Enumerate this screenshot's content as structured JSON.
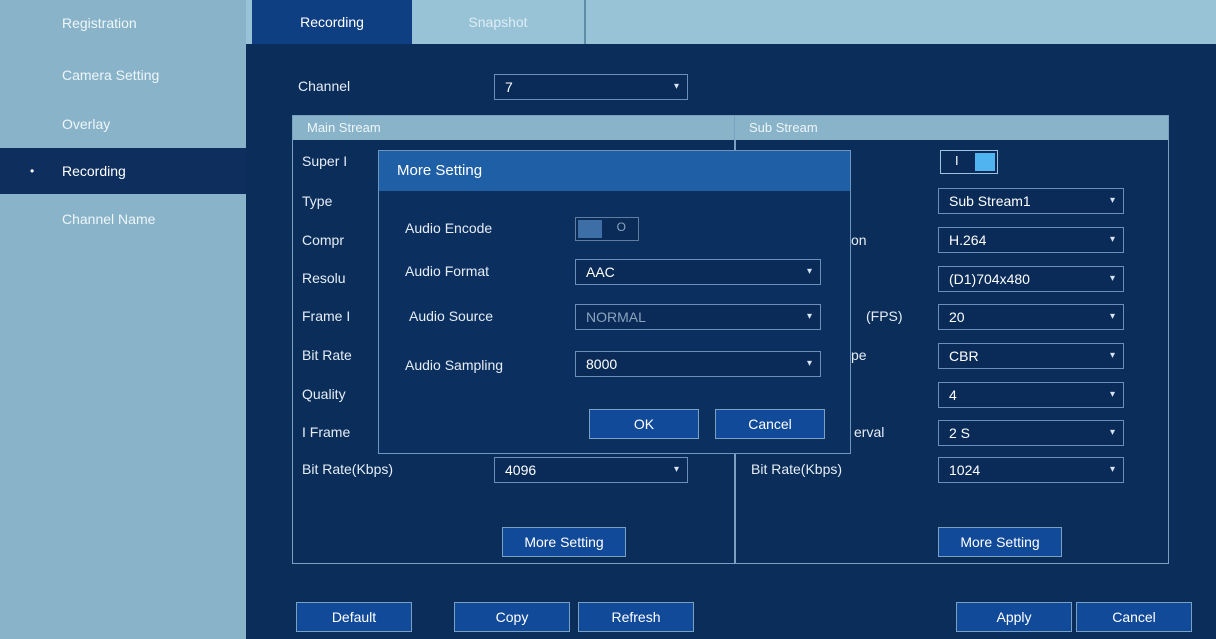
{
  "sidebar": {
    "items": [
      {
        "label": "Registration"
      },
      {
        "label": "Camera Setting"
      },
      {
        "label": "Overlay"
      },
      {
        "label": "Recording",
        "bullet": "•"
      },
      {
        "label": "Channel Name"
      }
    ]
  },
  "tabs": [
    {
      "label": "Recording"
    },
    {
      "label": "Snapshot"
    }
  ],
  "channel": {
    "label": "Channel",
    "value": "7"
  },
  "main_stream": {
    "title": "Main Stream",
    "labels": [
      "Super I",
      "Type",
      "Compr",
      "Resolu",
      "Frame I",
      "Bit Rate",
      "Quality",
      "I Frame",
      "Bit Rate(Kbps)"
    ],
    "bitrate": {
      "value": "4096"
    },
    "more_setting": "More Setting"
  },
  "sub_stream": {
    "title": "Sub Stream",
    "labels": [
      "on",
      "(FPS)",
      "pe",
      "erval",
      "Bit Rate(Kbps)"
    ],
    "fields": [
      {
        "value": "Sub Stream1"
      },
      {
        "value": "H.264"
      },
      {
        "value": "(D1)704x480"
      },
      {
        "value": "20"
      },
      {
        "value": "CBR"
      },
      {
        "value": "4"
      },
      {
        "value": "2 S"
      },
      {
        "value": "1024"
      }
    ],
    "more_setting": "More Setting"
  },
  "dialog": {
    "title": "More Setting",
    "audio_encode_label": "Audio Encode",
    "audio_encode_mark": "O",
    "audio_format_label": "Audio Format",
    "audio_format_value": "AAC",
    "audio_source_label": "Audio Source",
    "audio_source_value": "NORMAL",
    "audio_sampling_label": "Audio Sampling",
    "audio_sampling_value": "8000",
    "ok": "OK",
    "cancel": "Cancel"
  },
  "footer": {
    "default": "Default",
    "copy": "Copy",
    "refresh": "Refresh",
    "apply": "Apply",
    "cancel": "Cancel"
  },
  "toggle": {
    "mark": "I"
  },
  "icons": {
    "caret": "▾"
  },
  "colors": {
    "background": "#0a2d5a",
    "sidebar": "#88b3c8",
    "tab_active": "#0f3f83",
    "button": "#124a9a",
    "dialog_title": "#1e5fa6",
    "toggle_on": "#4fb4f0"
  }
}
